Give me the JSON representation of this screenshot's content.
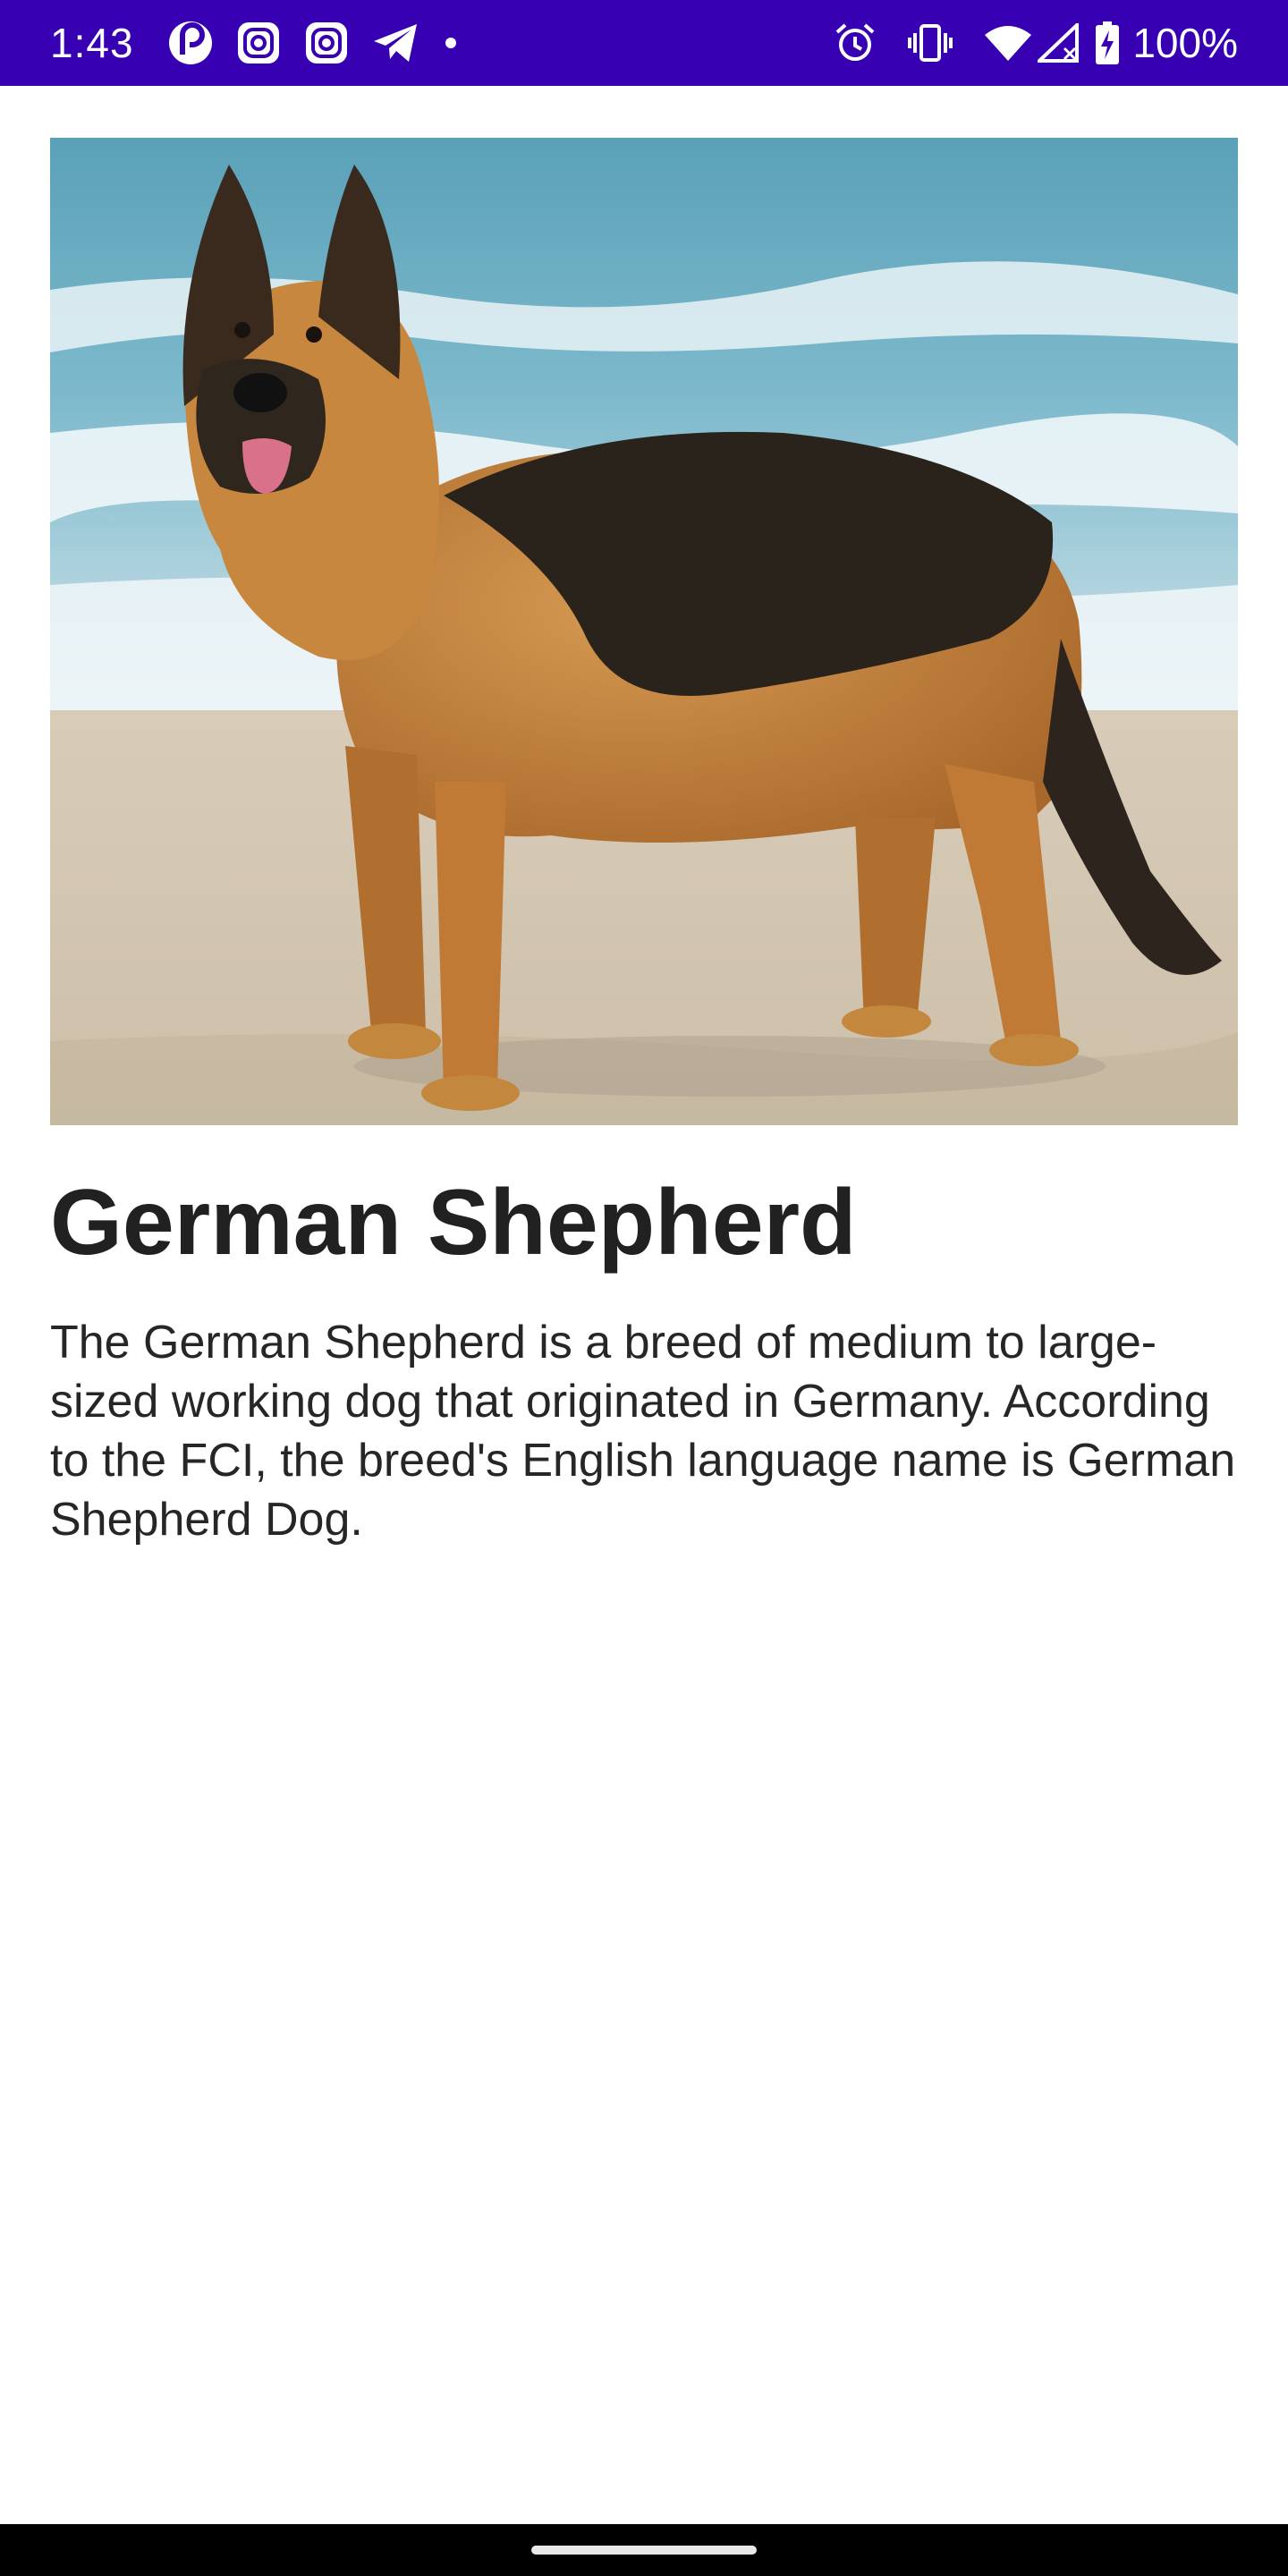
{
  "status_bar": {
    "time": "1:43",
    "battery_text": "100%",
    "background": "#3700b3",
    "left_icons": [
      "pocket-casts-icon",
      "instagram-icon",
      "instagram-icon",
      "telegram-icon",
      "notification-dot-icon"
    ],
    "right_icons": [
      "alarm-icon",
      "vibrate-icon",
      "wifi-icon",
      "no-signal-icon",
      "battery-charging-icon"
    ]
  },
  "detail": {
    "image_icon": "german-shepherd-photo",
    "title": "German Shepherd",
    "description": "The German Shepherd is a breed of medium to large-sized working dog that originated in Germany. According to the FCI, the breed's English language name is German Shepherd Dog."
  },
  "nav_bar": {
    "handle_icon": "gesture-handle"
  }
}
